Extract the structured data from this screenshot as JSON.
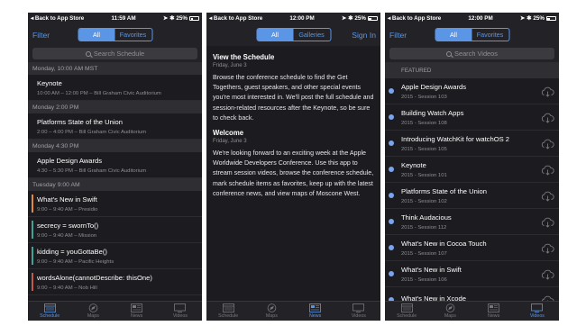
{
  "status_common": {
    "back": "Back to App Store",
    "battery": "25%"
  },
  "schedule_screen": {
    "time": "11:59 AM",
    "nav_left": "Filter",
    "seg": [
      "All",
      "Favorites"
    ],
    "search_placeholder": "Search Schedule",
    "groups": [
      {
        "header": "Monday, 10:00 AM MST",
        "items": [
          {
            "title": "Keynote",
            "sub": "10:00 AM – 12:00 PM – Bill Graham Civic Auditorium",
            "color": "#1c1c20"
          }
        ]
      },
      {
        "header": "Monday 2:00 PM",
        "items": [
          {
            "title": "Platforms State of the Union",
            "sub": "2:00 – 4:00 PM – Bill Graham Civic Auditorium",
            "color": "#1c1c20"
          }
        ]
      },
      {
        "header": "Monday 4:30 PM",
        "items": [
          {
            "title": "Apple Design Awards",
            "sub": "4:30 – 5:30 PM – Bill Graham Civic Auditorium",
            "color": "#1c1c20"
          }
        ]
      },
      {
        "header": "Tuesday 9:00 AM",
        "items": [
          {
            "title": "What's New in Swift",
            "sub": "9:00 – 9:40 AM – Presidio",
            "color": "#e08a3c"
          },
          {
            "title": "secrecy = swornTo()",
            "sub": "9:00 – 9:40 AM – Mission",
            "color": "#3fa39a"
          },
          {
            "title": "kidding = youGottaBe()",
            "sub": "9:00 – 9:40 AM – Pacific Heights",
            "color": "#3fa39a"
          },
          {
            "title": "wordsAlone(cannotDescribe: thisOne)",
            "sub": "9:00 – 9:40 AM – Nob Hill",
            "color": "#c05a4a"
          }
        ]
      }
    ]
  },
  "news_screen": {
    "time": "12:00 PM",
    "seg": [
      "All",
      "Galleries"
    ],
    "nav_right": "Sign In",
    "articles": [
      {
        "title": "View the Schedule",
        "date": "Friday, June 3",
        "body": "Browse the conference schedule to find the Get Togethers, guest speakers, and other special events you're most interested in. We'll post the full schedule and session-related resources after the Keynote, so be sure to check back."
      },
      {
        "title": "Welcome",
        "date": "Friday, June 3",
        "body": "We're looking forward to an exciting week at the Apple Worldwide Developers Conference. Use this app to stream session videos, browse the conference schedule, mark schedule items as favorites, keep up with the latest conference news, and view maps of Moscone West."
      }
    ]
  },
  "videos_screen": {
    "time": "12:00 PM",
    "nav_left": "Filter",
    "seg": [
      "All",
      "Favorites"
    ],
    "search_placeholder": "Search Videos",
    "section": "FEATURED",
    "videos": [
      {
        "title": "Apple Design Awards",
        "sub": "2015 - Session 103"
      },
      {
        "title": "Building Watch Apps",
        "sub": "2015 - Session 108"
      },
      {
        "title": "Introducing WatchKit for watchOS 2",
        "sub": "2015 - Session 105"
      },
      {
        "title": "Keynote",
        "sub": "2015 - Session 101"
      },
      {
        "title": "Platforms State of the Union",
        "sub": "2015 - Session 102"
      },
      {
        "title": "Think Audacious",
        "sub": "2015 - Session 112"
      },
      {
        "title": "What's New in Cocoa Touch",
        "sub": "2015 - Session 107"
      },
      {
        "title": "What's New in Swift",
        "sub": "2015 - Session 106"
      },
      {
        "title": "What's New in Xcode",
        "sub": ""
      }
    ]
  },
  "tabs": [
    "Schedule",
    "Maps",
    "News",
    "Videos"
  ],
  "accent": "#5a95e6"
}
